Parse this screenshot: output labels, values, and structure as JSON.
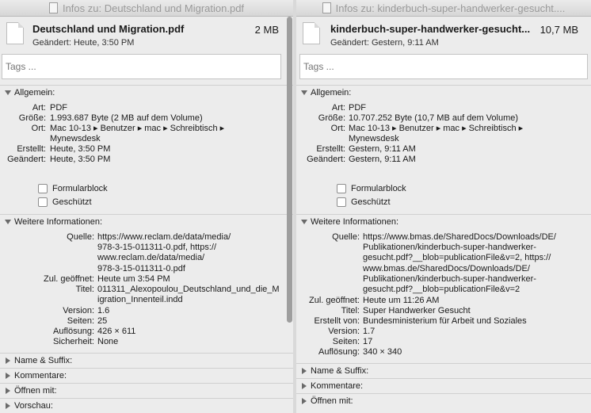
{
  "left": {
    "window_title": "Infos zu: Deutschland und Migration.pdf",
    "filename": "Deutschland und Migration.pdf",
    "size": "2 MB",
    "modified": "Geändert: Heute, 3:50 PM",
    "tags_placeholder": "Tags ...",
    "general": {
      "heading": "Allgemein:",
      "rows": [
        {
          "key": "Art:",
          "value": "PDF"
        },
        {
          "key": "Größe:",
          "value": "1.993.687 Byte (2 MB auf dem Volume)"
        },
        {
          "key": "Ort:",
          "value": "Mac 10-13 ▸ Benutzer ▸ mac ▸ Schreibtisch ▸\nMynewsdesk"
        },
        {
          "key": "Erstellt:",
          "value": "Heute, 3:50 PM"
        },
        {
          "key": "Geändert:",
          "value": "Heute, 3:50 PM"
        }
      ],
      "formblock": "Formularblock",
      "protected": "Geschützt"
    },
    "more": {
      "heading": "Weitere Informationen:",
      "rows": [
        {
          "key": "Quelle:",
          "value": "https://www.reclam.de/data/media/\n978-3-15-011311-0.pdf, https://\nwww.reclam.de/data/media/\n978-3-15-011311-0.pdf"
        },
        {
          "key": "Zul. geöffnet:",
          "value": "Heute um 3:54 PM"
        },
        {
          "key": "Titel:",
          "value": "011311_Alexopoulou_Deutschland_und_die_M\nigration_Innenteil.indd"
        },
        {
          "key": "Version:",
          "value": "1.6"
        },
        {
          "key": "Seiten:",
          "value": "25"
        },
        {
          "key": "Auflösung:",
          "value": "426 × 611"
        },
        {
          "key": "Sicherheit:",
          "value": "None"
        }
      ]
    },
    "collapsed": [
      "Name & Suffix:",
      "Kommentare:",
      "Öffnen mit:",
      "Vorschau:"
    ]
  },
  "right": {
    "window_title": "Infos zu: kinderbuch-super-handwerker-gesucht....",
    "filename": "kinderbuch-super-handwerker-gesucht...",
    "size": "10,7 MB",
    "modified": "Geändert: Gestern, 9:11 AM",
    "tags_placeholder": "Tags ...",
    "general": {
      "heading": "Allgemein:",
      "rows": [
        {
          "key": "Art:",
          "value": "PDF"
        },
        {
          "key": "Größe:",
          "value": "10.707.252 Byte (10,7 MB auf dem Volume)"
        },
        {
          "key": "Ort:",
          "value": "Mac 10-13 ▸ Benutzer ▸ mac ▸ Schreibtisch ▸\nMynewsdesk"
        },
        {
          "key": "Erstellt:",
          "value": "Gestern, 9:11 AM"
        },
        {
          "key": "Geändert:",
          "value": "Gestern, 9:11 AM"
        }
      ],
      "formblock": "Formularblock",
      "protected": "Geschützt"
    },
    "more": {
      "heading": "Weitere Informationen:",
      "rows": [
        {
          "key": "Quelle:",
          "value": "https://www.bmas.de/SharedDocs/Downloads/DE/\nPublikationen/kinderbuch-super-handwerker-\ngesucht.pdf?__blob=publicationFile&v=2, https://\nwww.bmas.de/SharedDocs/Downloads/DE/\nPublikationen/kinderbuch-super-handwerker-\ngesucht.pdf?__blob=publicationFile&v=2"
        },
        {
          "key": "Zul. geöffnet:",
          "value": "Heute um 11:26 AM"
        },
        {
          "key": "Titel:",
          "value": "Super Handwerker Gesucht"
        },
        {
          "key": "Erstellt von:",
          "value": "Bundesministerium für Arbeit und Soziales"
        },
        {
          "key": "Version:",
          "value": "1.7"
        },
        {
          "key": "Seiten:",
          "value": "17"
        },
        {
          "key": "Auflösung:",
          "value": "340 × 340"
        }
      ]
    },
    "collapsed": [
      "Name & Suffix:",
      "Kommentare:",
      "Öffnen mit:"
    ]
  }
}
